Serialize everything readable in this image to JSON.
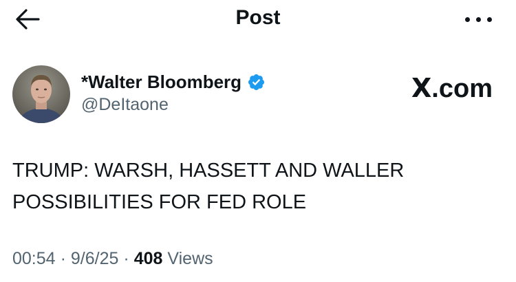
{
  "header": {
    "title": "Post",
    "back_icon": "back-arrow-icon",
    "more_icon": "more-horizontal-icon"
  },
  "author": {
    "display_name": "*Walter Bloomberg",
    "handle": "@DeItaone",
    "verified_icon": "verified-badge-icon",
    "verified_color": "#1d9bf0"
  },
  "source_logo": {
    "letter": "X",
    "suffix": ".com"
  },
  "tweet": {
    "lines": [
      "TRUMP: WARSH, HASSETT AND WALLER",
      "POSSIBILITIES FOR FED ROLE"
    ]
  },
  "meta": {
    "time": "00:54",
    "separator": "·",
    "date": "9/6/25",
    "views_count": "408",
    "views_label": "Views"
  },
  "colors": {
    "text_primary": "#0f1419",
    "text_secondary": "#536471",
    "accent": "#1d9bf0"
  }
}
